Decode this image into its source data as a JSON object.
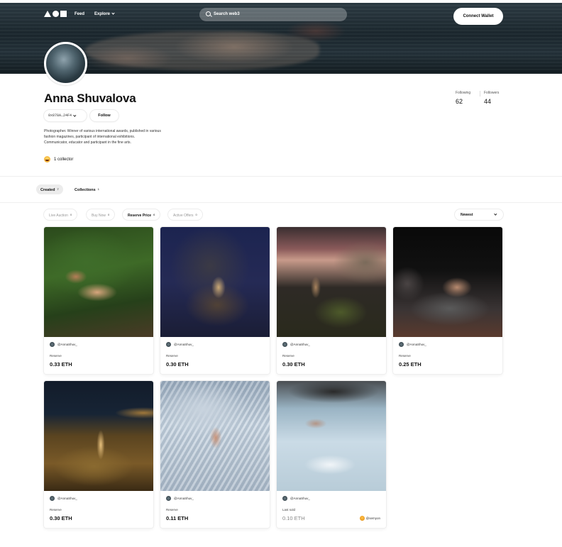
{
  "nav": {
    "feed": "Feed",
    "explore": "Explore",
    "search_placeholder": "Search web3",
    "connect_wallet": "Connect Wallet"
  },
  "profile": {
    "name": "Anna Shuvalova",
    "wallet": "0x878A…24F4",
    "follow": "Follow",
    "bio": [
      "Photographer. Winner of various international awards, published in various",
      "fashion magazines, participant of international exhibitions.",
      "Communicator, educator and participant in the fine arts."
    ],
    "collectors": "1 collector",
    "following_label": "Following",
    "following_value": "62",
    "followers_label": "Followers",
    "followers_value": "44"
  },
  "tabs": [
    {
      "label": "Created",
      "count": "7"
    },
    {
      "label": "Collections",
      "count": "1"
    }
  ],
  "filters": [
    {
      "label": "Live Auction",
      "count": "0"
    },
    {
      "label": "Buy Now",
      "count": "0"
    },
    {
      "label": "Reserve Price",
      "count": "6"
    },
    {
      "label": "Active Offers",
      "count": "0"
    }
  ],
  "sort": "Newest",
  "cards": [
    {
      "owner": "@AnnaShuv_",
      "label": "Reserve",
      "price": "0.33 ETH"
    },
    {
      "owner": "@AnnaShuv_",
      "label": "Reserve",
      "price": "0.30 ETH"
    },
    {
      "owner": "@AnnaShuv_",
      "label": "Reserve",
      "price": "0.30 ETH"
    },
    {
      "owner": "@AnnaShuv_",
      "label": "Reserve",
      "price": "0.25 ETH"
    },
    {
      "owner": "@AnnaShuv_",
      "label": "Reserve",
      "price": "0.30 ETH"
    },
    {
      "owner": "@AnnaShuv_",
      "label": "Reserve",
      "price": "0.11 ETH"
    },
    {
      "owner": "@AnnaShuv_",
      "label": "Last sold",
      "price": "0.10 ETH",
      "buyer": "@semyon"
    }
  ]
}
